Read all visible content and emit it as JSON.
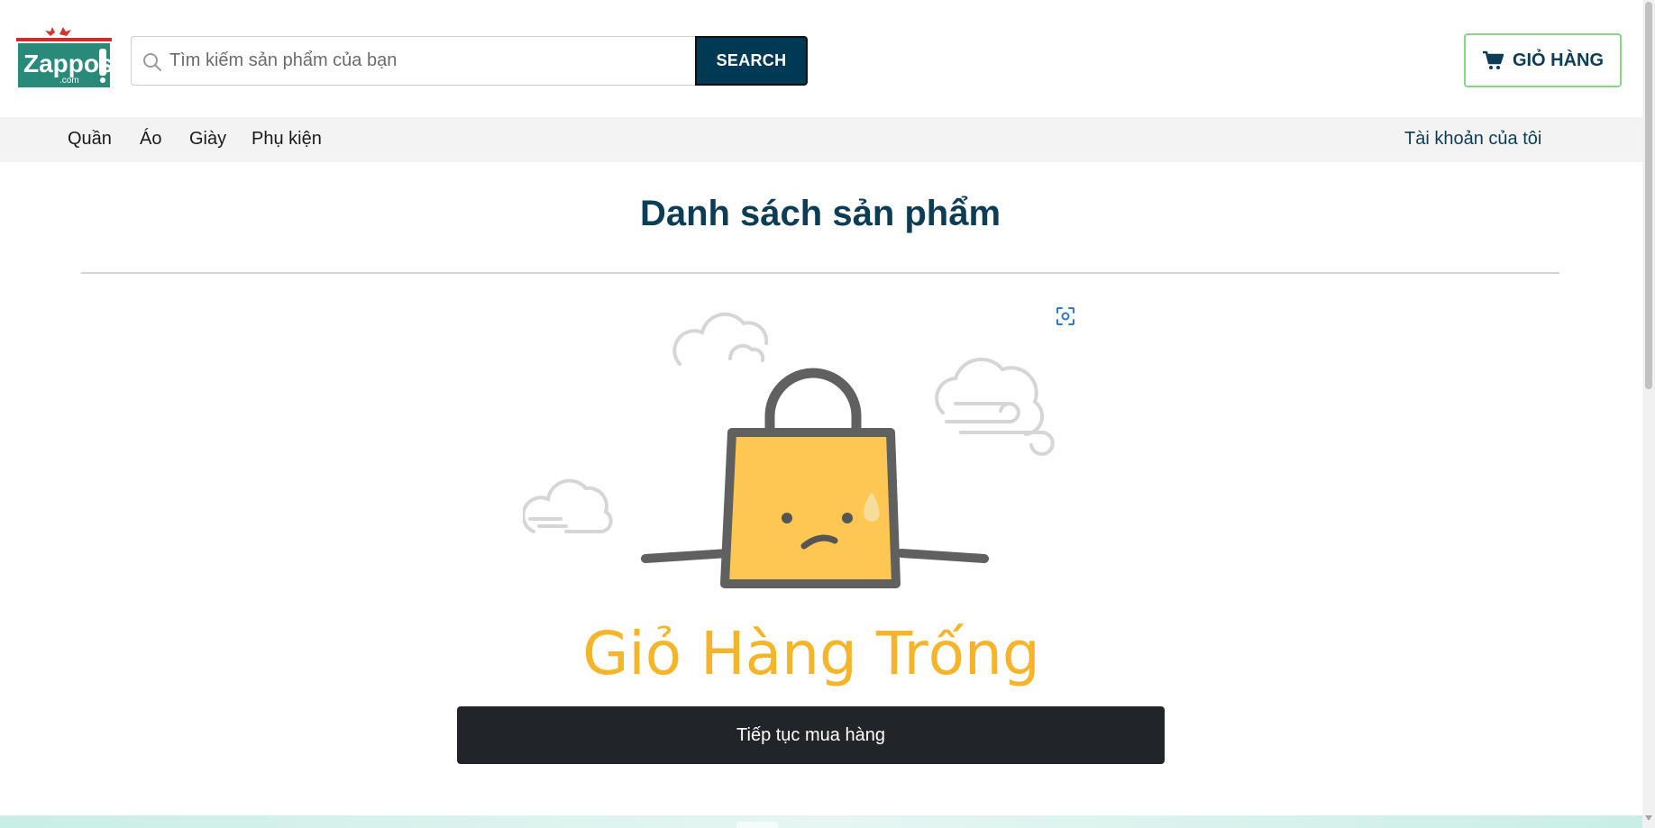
{
  "brand": {
    "logo_text": "Zappos",
    "logo_sub": ".com"
  },
  "search": {
    "placeholder": "Tìm kiếm sản phẩm của bạn",
    "value": "",
    "button_label": "SEARCH"
  },
  "cart": {
    "label": "GIỎ HÀNG"
  },
  "nav": {
    "items": [
      {
        "label": "Quần"
      },
      {
        "label": "Áo"
      },
      {
        "label": "Giày"
      },
      {
        "label": "Phụ kiện"
      }
    ],
    "account_label": "Tài khoản của tôi"
  },
  "main": {
    "title": "Danh sách sản phẩm",
    "empty_cart_text": "Giỏ Hàng Trống",
    "continue_label": "Tiếp tục mua hàng"
  },
  "colors": {
    "primary": "#0c3d55",
    "search_button": "#003953",
    "cart_border": "#8cd48e",
    "empty_text": "#f5b52a",
    "bag": "#fdc751",
    "continue_button": "#212529"
  },
  "icons": [
    "search-icon",
    "cart-icon",
    "capture-icon",
    "empty-bag-illustration"
  ]
}
